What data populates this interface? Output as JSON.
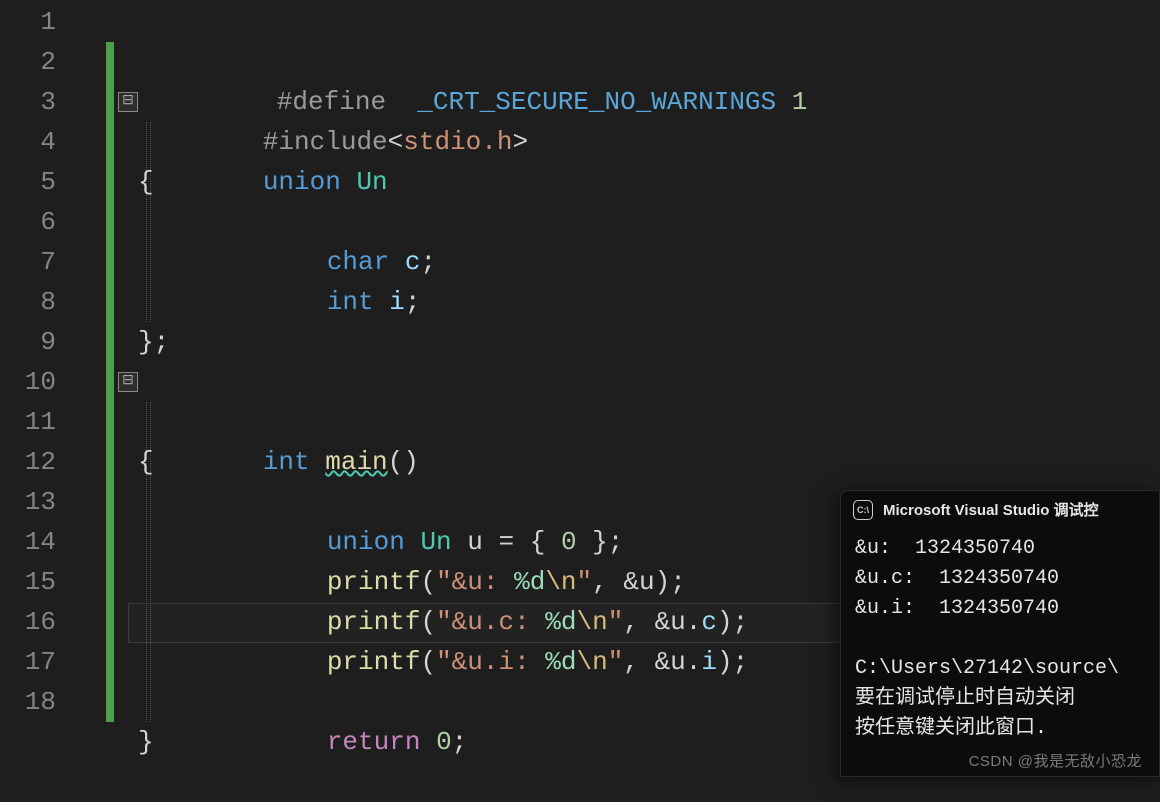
{
  "line_numbers": [
    "1",
    "2",
    "3",
    "4",
    "5",
    "6",
    "7",
    "8",
    "9",
    "10",
    "11",
    "12",
    "13",
    "14",
    "15",
    "16",
    "17",
    "18"
  ],
  "code": {
    "l1": {
      "define": "#define  ",
      "macro": "_CRT_SECURE_NO_WARNINGS",
      "sp": " ",
      "one": "1"
    },
    "l2": {
      "include": "#include",
      "lt": "<",
      "hdr": "stdio.h",
      "gt": ">"
    },
    "l3": {
      "union": "union",
      "sp": " ",
      "name": "Un"
    },
    "l4": {
      "brace": "{"
    },
    "l5": {
      "type": "char",
      "sp": " ",
      "id": "c",
      "semi": ";"
    },
    "l6": {
      "type": "int",
      "sp": " ",
      "id": "i",
      "semi": ";"
    },
    "l7": {
      "blank": ""
    },
    "l8": {
      "brace": "}",
      "semi": ";"
    },
    "l9": {
      "blank": ""
    },
    "l10": {
      "type": "int",
      "sp": " ",
      "fn": "main",
      "paren": "()"
    },
    "l11": {
      "brace": "{"
    },
    "l12": {
      "kw": "union",
      "sp1": " ",
      "tn": "Un",
      "sp2": " ",
      "var": "u",
      "sp3": " ",
      "eq": "=",
      "sp4": " ",
      "lb": "{",
      "sp5": " ",
      "zero": "0",
      "sp6": " ",
      "rb": "}",
      "semi": ";"
    },
    "l13": {
      "fn": "printf",
      "lp": "(",
      "q1": "\"",
      "txt": "&u: ",
      "fmt": "%d",
      "esc": "\\n",
      "q2": "\"",
      "comma": ", ",
      "amp": "&",
      "var": "u",
      "rp": ")",
      "semi": ";"
    },
    "l14": {
      "fn": "printf",
      "lp": "(",
      "q1": "\"",
      "txt": "&u.c: ",
      "fmt": "%d",
      "esc": "\\n",
      "q2": "\"",
      "comma": ", ",
      "amp": "&",
      "var": "u",
      "dot": ".",
      "mem": "c",
      "rp": ")",
      "semi": ";"
    },
    "l15": {
      "fn": "printf",
      "lp": "(",
      "q1": "\"",
      "txt": "&u.i: ",
      "fmt": "%d",
      "esc": "\\n",
      "q2": "\"",
      "comma": ", ",
      "amp": "&",
      "var": "u",
      "dot": ".",
      "mem": "i",
      "rp": ")",
      "semi": ";"
    },
    "l16": {
      "blank": ""
    },
    "l17": {
      "ret": "return",
      "sp": " ",
      "zero": "0",
      "semi": ";"
    },
    "l18": {
      "brace": "}"
    }
  },
  "fold_glyph": "⊟",
  "console": {
    "title": "Microsoft Visual Studio 调试控",
    "icon_text": "C:\\",
    "out1": "&u:  1324350740",
    "out2": "&u.c:  1324350740",
    "out3": "&u.i:  1324350740",
    "blank": "",
    "path": "C:\\Users\\27142\\source\\",
    "msg1": "要在调试停止时自动关闭",
    "msg2": "按任意键关闭此窗口. "
  },
  "watermark": "CSDN @我是无敌小恐龙"
}
